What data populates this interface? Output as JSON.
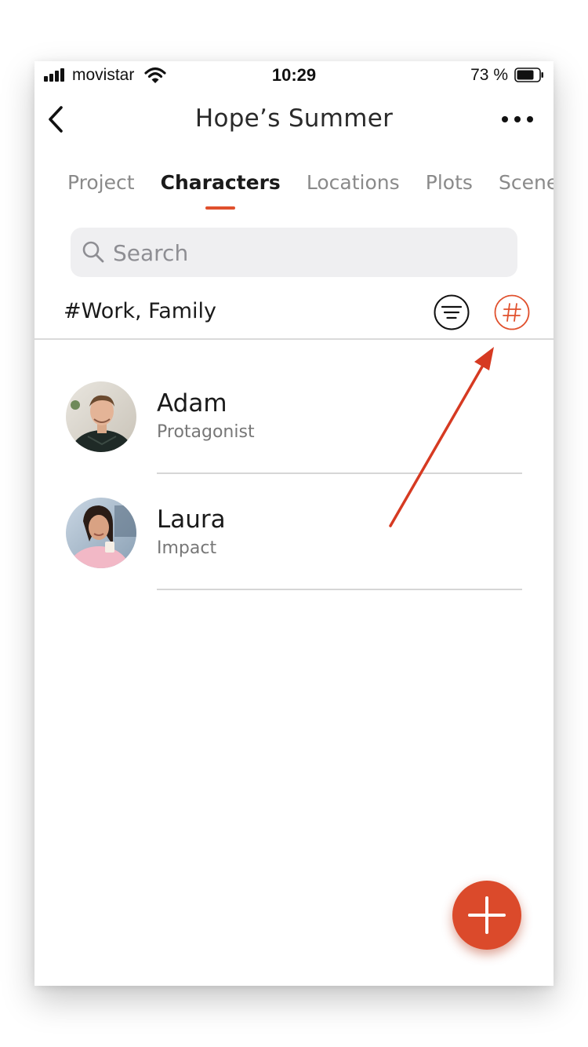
{
  "status_bar": {
    "carrier": "movistar",
    "time": "10:29",
    "battery": "73 %"
  },
  "nav": {
    "title": "Hope’s Summer"
  },
  "tabs": [
    {
      "label": "Project",
      "active": false
    },
    {
      "label": "Characters",
      "active": true
    },
    {
      "label": "Locations",
      "active": false
    },
    {
      "label": "Plots",
      "active": false
    },
    {
      "label": "Scenes",
      "active": false
    }
  ],
  "search": {
    "placeholder": "Search"
  },
  "filter": {
    "tags_label": "#Work, Family"
  },
  "characters": [
    {
      "name": "Adam",
      "role": "Protagonist"
    },
    {
      "name": "Laura",
      "role": "Impact"
    }
  ],
  "colors": {
    "accent": "#e0502d",
    "fab": "#db4a2b",
    "annotation_arrow": "#d63a22"
  },
  "icons": {
    "back": "chevron-left-icon",
    "more": "ellipsis-icon",
    "search": "search-icon",
    "filter": "filter-icon",
    "tags": "hashtag-icon",
    "add": "plus-icon"
  }
}
